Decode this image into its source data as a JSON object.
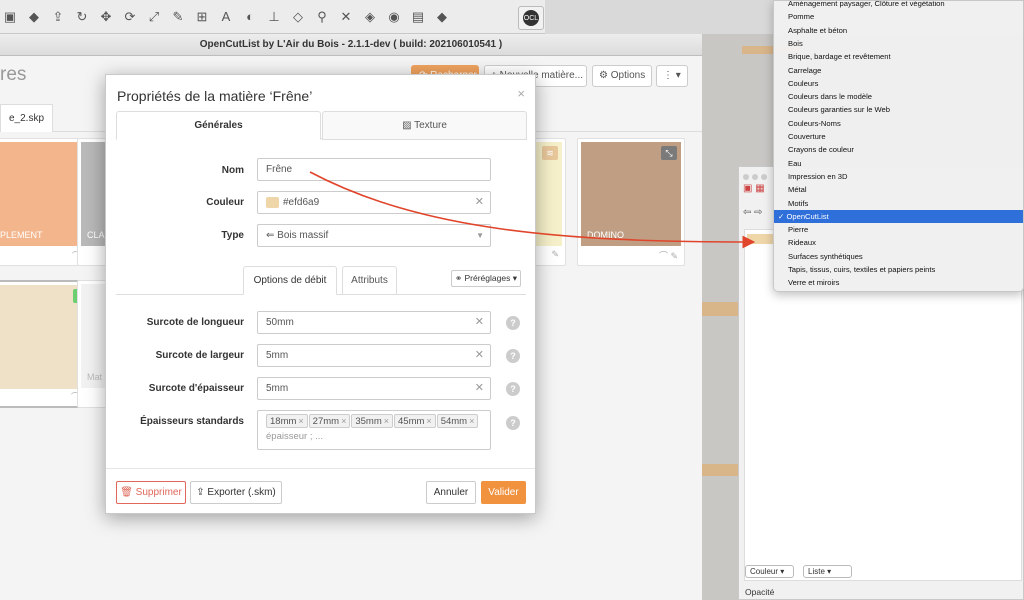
{
  "toolbar": {
    "icons": [
      "material-icon",
      "paint-bucket-icon",
      "push-pull-icon",
      "follow-me-icon",
      "move-icon",
      "rotate-icon",
      "scale-icon",
      "tape-measure-icon",
      "dimension-icon",
      "text-icon",
      "protractor-icon",
      "axes-icon",
      "eraser-icon",
      "zoom-icon",
      "zoom-extents-icon",
      "sandbox-icon",
      "hat-icon",
      "layers-icon",
      "diamond-icon"
    ],
    "extension_icon_label": "OCL"
  },
  "ocl_window": {
    "title": "OpenCutList by L'Air du Bois - 2.1.1-dev ( build: 202106010541 )",
    "heading": "res",
    "buttons": {
      "reload": "Recharger",
      "new_material": "Nouvelle matière...",
      "options": "Options"
    },
    "file_tab": "e_2.skp"
  },
  "material_cards": [
    {
      "label": "PLEMENT",
      "color": "#f2b58c",
      "badge": "?"
    },
    {
      "label": "CLA",
      "color": "#b9b9b9",
      "badge": ""
    },
    {
      "label": "",
      "color": "#f5f0c9",
      "badge": ""
    },
    {
      "label": "DOMINO",
      "color": "#bf9e83",
      "badge": ""
    },
    {
      "label": "",
      "color": "#efe1c7",
      "badge": ""
    },
    {
      "label": "Mat",
      "color": "#f2f2f2",
      "badge": ""
    }
  ],
  "dialog": {
    "title": "Propriétés de la matière ‘Frêne’",
    "tabs": {
      "general": "Générales",
      "texture": "Texture"
    },
    "fields": {
      "name_label": "Nom",
      "name_value": "Frêne",
      "color_label": "Couleur",
      "color_value": "#efd6a9",
      "type_label": "Type",
      "type_value": "Bois massif"
    },
    "sub_tabs": {
      "cutting": "Options de débit",
      "attributes": "Attributs"
    },
    "presets": "Préréglages",
    "cutting": {
      "length_label": "Surcote de longueur",
      "length_value": "50mm",
      "width_label": "Surcote de largeur",
      "width_value": "5mm",
      "thickness_label": "Surcote d'épaisseur",
      "thickness_value": "5mm",
      "std_thickness_label": "Épaisseurs standards",
      "std_thicknesses": [
        "18mm",
        "27mm",
        "35mm",
        "45mm",
        "54mm"
      ],
      "std_thickness_placeholder": "épaisseur ; ..."
    },
    "buttons": {
      "delete": "Supprimer",
      "export": "Exporter (.skm)",
      "cancel": "Annuler",
      "validate": "Valider"
    }
  },
  "menu": {
    "items": [
      "Aménagement paysager, Clôture et végétation",
      "Pomme",
      "Asphalte et béton",
      "Bois",
      "Brique, bardage et revêtement",
      "Carrelage",
      "Couleurs",
      "Couleurs dans le modèle",
      "Couleurs garanties sur le Web",
      "Couleurs-Noms",
      "Couverture",
      "Crayons de couleur",
      "Eau",
      "Impression en 3D",
      "Métal",
      "Motifs",
      "OpenCutList",
      "Pierre",
      "Rideaux",
      "Surfaces synthétiques",
      "Tapis, tissus, cuirs, textiles et papiers peints",
      "Verre et miroirs"
    ],
    "selected_index": 16
  },
  "inspector": {
    "select_color": "Couleur",
    "select_list": "Liste",
    "opacity_label": "Opacité"
  },
  "colors": {
    "accent": "#f0923e",
    "danger": "#e0675a",
    "selection": "#2e6fd9",
    "arrow": "#e0452b"
  }
}
